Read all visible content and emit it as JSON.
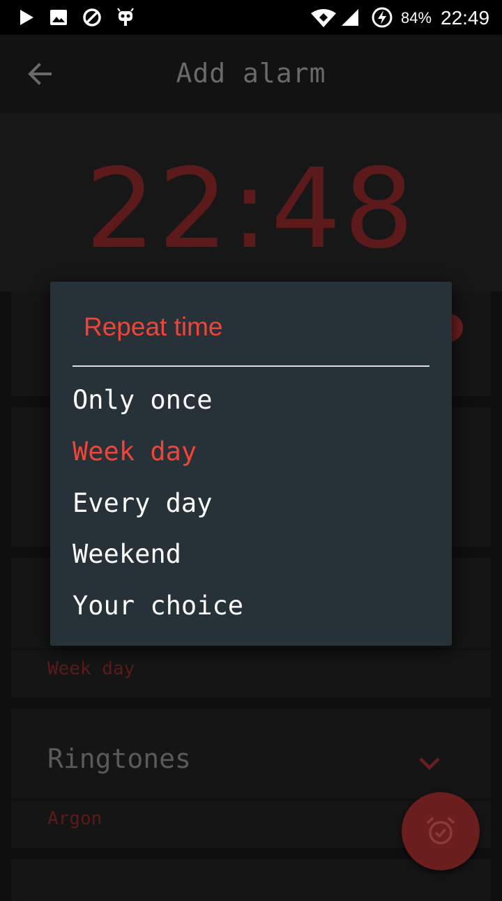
{
  "status_bar": {
    "battery": "84%",
    "time": "22:49",
    "icons": [
      "play-icon",
      "image-icon",
      "blocked-icon",
      "android-bug-icon",
      "wifi-icon",
      "signal-icon",
      "battery-charging-icon"
    ]
  },
  "app_bar": {
    "title": "Add alarm",
    "back_icon": "arrow-back-icon"
  },
  "alarm_time": "22:48",
  "cards": {
    "repeat_value": "Week day",
    "ringtones_label": "Ringtones",
    "ringtone_value": "Argon"
  },
  "dialog": {
    "title": "Repeat time",
    "options": [
      "Only once",
      "Week day",
      "Every day",
      "Weekend",
      "Your choice"
    ],
    "selected": "Week day"
  },
  "colors": {
    "accent": "#f44336",
    "dialog_bg": "#263238",
    "dim_red": "#5c1a1a"
  },
  "fab": {
    "icon": "alarm-check-icon"
  }
}
